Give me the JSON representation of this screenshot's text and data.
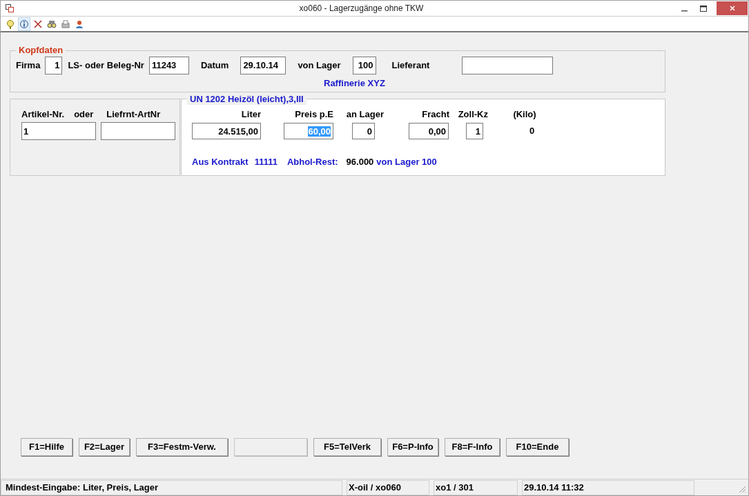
{
  "window": {
    "title": "xo060 - Lagerzugänge ohne TKW"
  },
  "toolbar": [
    {
      "kind": "help",
      "selected": false
    },
    {
      "kind": "info",
      "selected": true
    },
    {
      "kind": "delete",
      "selected": false
    },
    {
      "kind": "find",
      "selected": false
    },
    {
      "kind": "print",
      "selected": false
    },
    {
      "kind": "user",
      "selected": false
    }
  ],
  "header": {
    "legend": "Kopfdaten",
    "fields": [
      {
        "label": "Firma",
        "value": "1"
      },
      {
        "label": "LS- oder Beleg-Nr",
        "value": "11243"
      },
      {
        "label": "Datum",
        "value": "29.10.14"
      },
      {
        "label": "von Lager",
        "value": "100"
      },
      {
        "label": "Lieferant"
      }
    ],
    "supplier_name": "Raffinerie XYZ"
  },
  "article": {
    "labels": [
      "Artikel-Nr.",
      "oder",
      "Liefrnt-ArtNr"
    ],
    "article_no": "1"
  },
  "product": {
    "legend": "UN 1202 Heizöl (leicht),3,III",
    "columns": [
      {
        "label": "Liter",
        "value": "24.515,00",
        "focused": false
      },
      {
        "label": "Preis p.E",
        "value": "60,00",
        "focused": true
      },
      {
        "label": "an Lager",
        "value": "0",
        "focused": false
      },
      {
        "label": "Fracht",
        "value": "0,00",
        "focused": false
      },
      {
        "label": "Zoll-Kz",
        "value": "1",
        "focused": false
      }
    ],
    "kilo_label": "(Kilo)",
    "kilo_value": "0",
    "contract_label": "Aus Kontrakt",
    "contract_no": "11111",
    "rest_label": "Abhol-Rest:",
    "rest_value": "96.000",
    "rest_source": "von Lager 100"
  },
  "buttons": [
    {
      "label": "F1=Hilfe",
      "disabled": false
    },
    {
      "label": "F2=Lager",
      "disabled": false
    },
    {
      "label": "F3=Festm-Verw.",
      "disabled": false
    },
    {
      "disabled": true
    },
    {
      "label": "F5=TelVerk",
      "disabled": false
    },
    {
      "label": "F6=P-Info",
      "disabled": false
    },
    {
      "label": "F8=F-Info",
      "disabled": false
    },
    {
      "label": "F10=Ende",
      "disabled": false
    }
  ],
  "status_bar": [
    "Mindest-Eingabe: Liter, Preis, Lager",
    "X-oil / xo060",
    "xo1 / 301",
    "29.10.14 11:32"
  ]
}
